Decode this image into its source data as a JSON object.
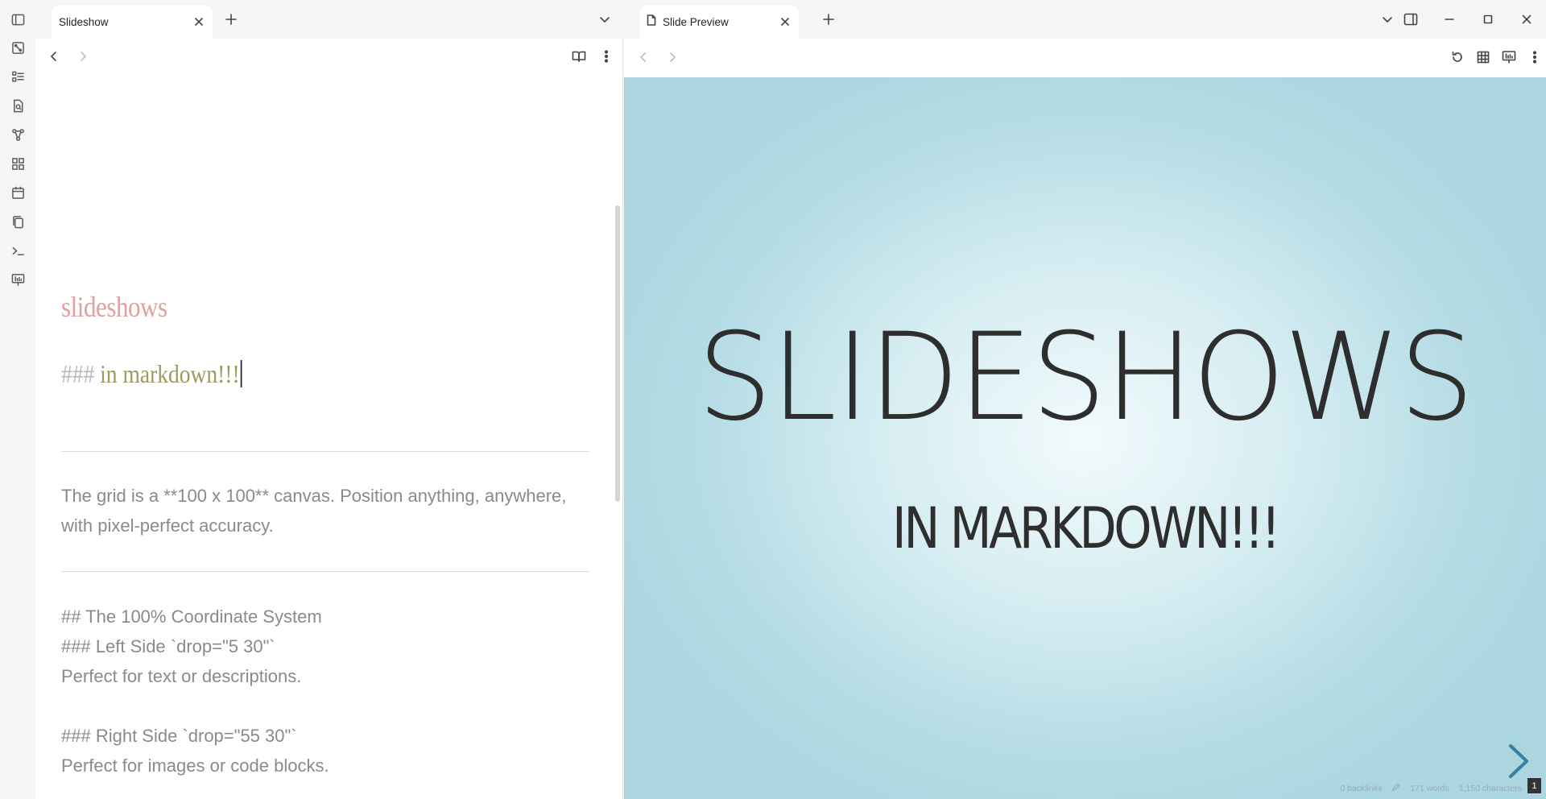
{
  "ribbon": {
    "icons": [
      "sidebar-toggle-icon",
      "canvas-icon",
      "outline-icon",
      "search-file-icon",
      "graph-icon",
      "dashboard-icon",
      "calendar-icon",
      "copy-icon",
      "terminal-icon",
      "slides-icon"
    ]
  },
  "left_pane": {
    "tab_title": "Slideshow",
    "editor": {
      "heading1": "slideshows",
      "heading3_hashes": "###",
      "heading3_text": "in markdown!!!",
      "paragraph1": " The grid is a **100 x 100** canvas. Position anything, anywhere, with pixel-perfect accuracy.",
      "lines": [
        " ## The 100% Coordinate System",
        " ### Left Side `drop=\"5 30\"`",
        "Perfect for text or descriptions.",
        "",
        " ### Right Side `drop=\"55 30\"`",
        "Perfect for images or code blocks."
      ]
    }
  },
  "right_pane": {
    "tab_title": "Slide Preview",
    "slide": {
      "title": "SLIDESHOWS",
      "subtitle": "IN MARKDOWN!!!",
      "slide_number": "1"
    },
    "status": {
      "backlinks": "0 backlinks",
      "words": "171 words",
      "characters": "1,150 characters"
    }
  },
  "colors": {
    "heading1": "#e0a0a0",
    "heading3": "#9c9a5c",
    "slide_bg_center": "#f2fafc",
    "slide_bg_edge": "#abd6e0",
    "next_arrow": "#3a7ea0"
  }
}
